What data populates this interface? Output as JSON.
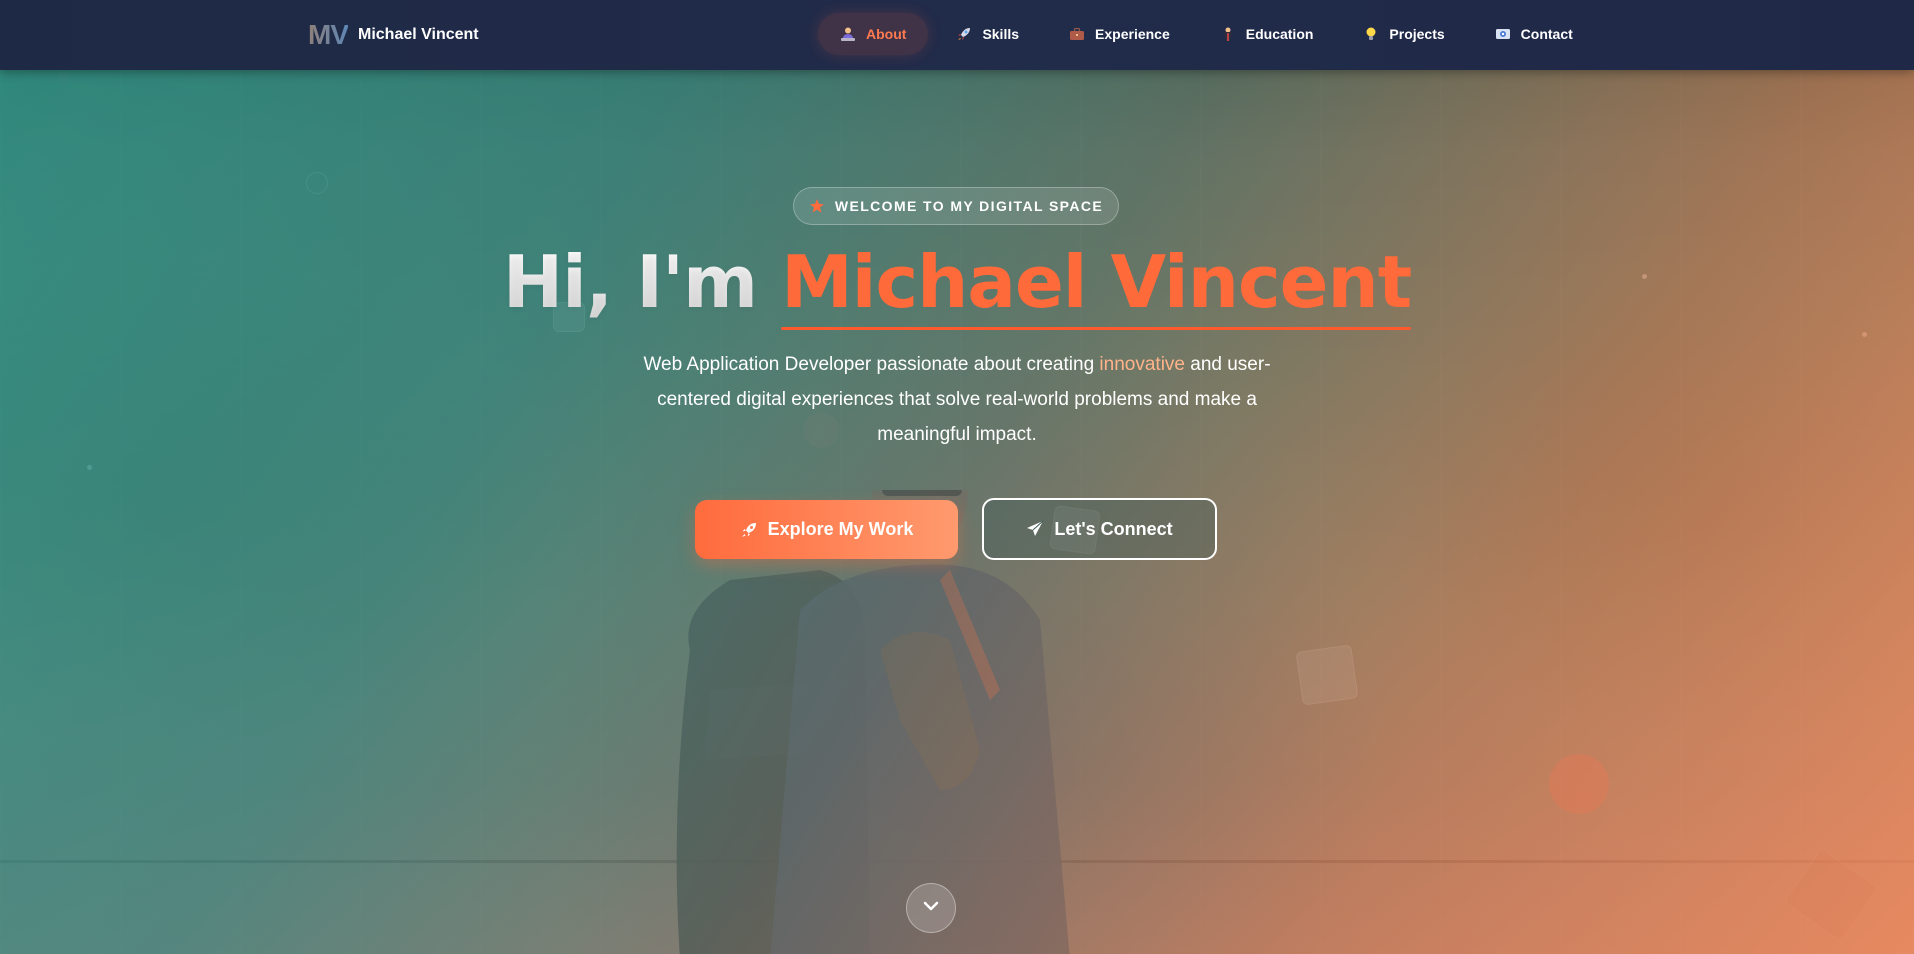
{
  "brand": {
    "logo": "MV",
    "name": "Michael Vincent"
  },
  "nav": {
    "items": [
      {
        "label": "About",
        "icon": "person-at-desk-icon",
        "active": true
      },
      {
        "label": "Skills",
        "icon": "rocket-icon",
        "active": false
      },
      {
        "label": "Experience",
        "icon": "briefcase-icon",
        "active": false
      },
      {
        "label": "Education",
        "icon": "graduation-icon",
        "active": false
      },
      {
        "label": "Projects",
        "icon": "lightbulb-icon",
        "active": false
      },
      {
        "label": "Contact",
        "icon": "id-card-icon",
        "active": false
      }
    ]
  },
  "hero": {
    "badge": "WELCOME TO MY DIGITAL SPACE",
    "headline_prefix": "Hi, I'm ",
    "headline_name": "Michael Vincent",
    "tagline_before": "Web Application Developer passionate about creating ",
    "tagline_accent": "innovative",
    "tagline_after": " and user-centered digital experiences that solve real-world problems and make a meaningful impact.",
    "primary_button": "Explore My Work",
    "secondary_button": "Let's Connect"
  },
  "colors": {
    "accent": "#ff6b3d",
    "navbar": "#1e2a45",
    "overlay_teal": "#30968c",
    "overlay_orange": "#f58c5f"
  }
}
